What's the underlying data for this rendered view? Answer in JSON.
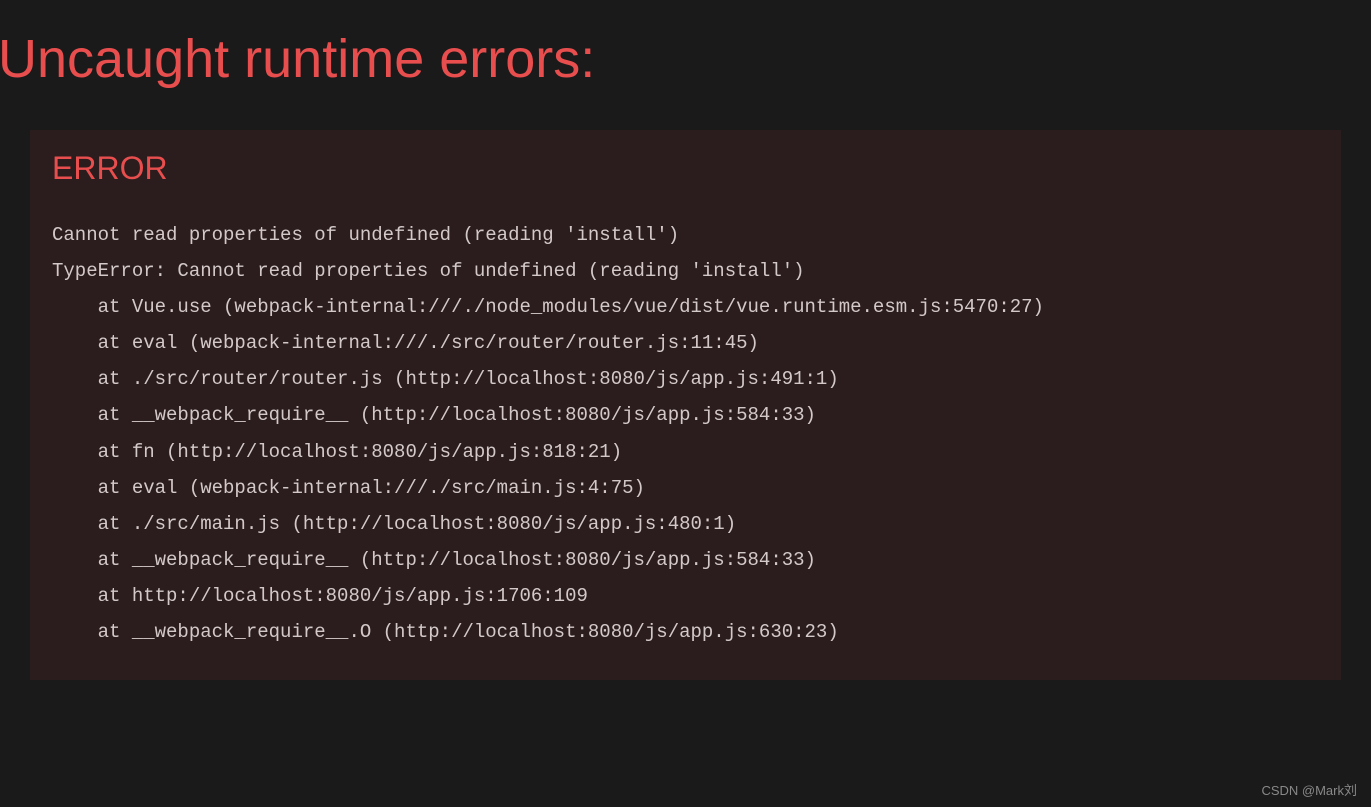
{
  "title": "Uncaught runtime errors:",
  "error": {
    "heading": "ERROR",
    "message": "Cannot read properties of undefined (reading 'install')",
    "stack": [
      "TypeError: Cannot read properties of undefined (reading 'install')",
      "    at Vue.use (webpack-internal:///./node_modules/vue/dist/vue.runtime.esm.js:5470:27)",
      "    at eval (webpack-internal:///./src/router/router.js:11:45)",
      "    at ./src/router/router.js (http://localhost:8080/js/app.js:491:1)",
      "    at __webpack_require__ (http://localhost:8080/js/app.js:584:33)",
      "    at fn (http://localhost:8080/js/app.js:818:21)",
      "    at eval (webpack-internal:///./src/main.js:4:75)",
      "    at ./src/main.js (http://localhost:8080/js/app.js:480:1)",
      "    at __webpack_require__ (http://localhost:8080/js/app.js:584:33)",
      "    at http://localhost:8080/js/app.js:1706:109",
      "    at __webpack_require__.O (http://localhost:8080/js/app.js:630:23)"
    ]
  },
  "watermark": "CSDN @Mark刘"
}
